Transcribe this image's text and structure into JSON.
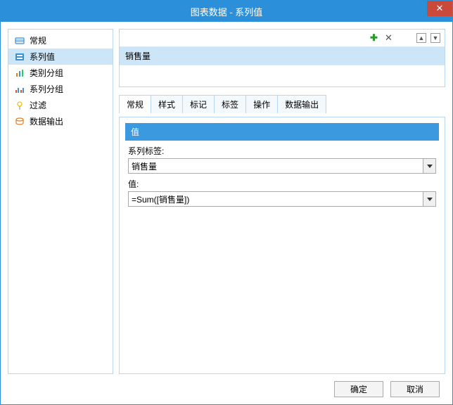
{
  "title": "图表数据 - 系列值",
  "sidebar": {
    "items": [
      {
        "label": "常规"
      },
      {
        "label": "系列值"
      },
      {
        "label": "类别分组"
      },
      {
        "label": "系列分组"
      },
      {
        "label": "过滤"
      },
      {
        "label": "数据输出"
      }
    ]
  },
  "list": {
    "items": [
      {
        "label": "销售量"
      }
    ]
  },
  "tabs": {
    "items": [
      {
        "label": "常规"
      },
      {
        "label": "样式"
      },
      {
        "label": "标记"
      },
      {
        "label": "标签"
      },
      {
        "label": "操作"
      },
      {
        "label": "数据输出"
      }
    ]
  },
  "section": {
    "header": "值"
  },
  "fields": {
    "series_label": {
      "label": "系列标签:",
      "value": "销售量"
    },
    "value_expr": {
      "label": "值:",
      "value": "=Sum([销售量])"
    }
  },
  "buttons": {
    "ok": "确定",
    "cancel": "取消"
  }
}
